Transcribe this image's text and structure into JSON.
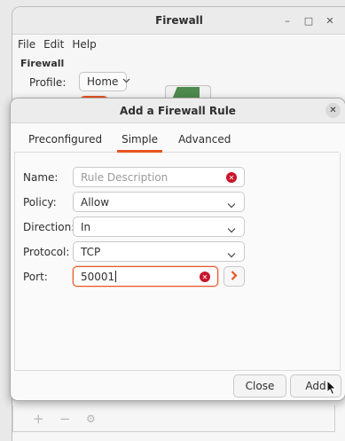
{
  "main_window": {
    "title": "Firewall",
    "menu": [
      "File",
      "Edit",
      "Help"
    ],
    "section_heading": "Firewall",
    "profile_label": "Profile:",
    "profile_value": "Home"
  },
  "dialog": {
    "title": "Add a Firewall Rule",
    "tabs": [
      {
        "label": "Preconfigured",
        "active": false
      },
      {
        "label": "Simple",
        "active": true
      },
      {
        "label": "Advanced",
        "active": false
      }
    ],
    "fields": {
      "name": {
        "label": "Name:",
        "placeholder": "Rule Description",
        "value": ""
      },
      "policy": {
        "label": "Policy:",
        "value": "Allow"
      },
      "direction": {
        "label": "Direction:",
        "value": "In"
      },
      "protocol": {
        "label": "Protocol:",
        "value": "TCP"
      },
      "port": {
        "label": "Port:",
        "value": "50001"
      }
    },
    "buttons": {
      "close": "Close",
      "add": "Add"
    }
  },
  "colors": {
    "accent": "#e95420",
    "error": "#c7162b",
    "profile_shield": "#4d8a4d"
  },
  "icons": [
    "minimize-icon",
    "maximize-icon",
    "close-icon",
    "chevron-down-icon",
    "clear-icon",
    "chevron-right-icon",
    "plus-icon",
    "minus-icon",
    "gear-icon",
    "mouse-pointer-icon"
  ]
}
